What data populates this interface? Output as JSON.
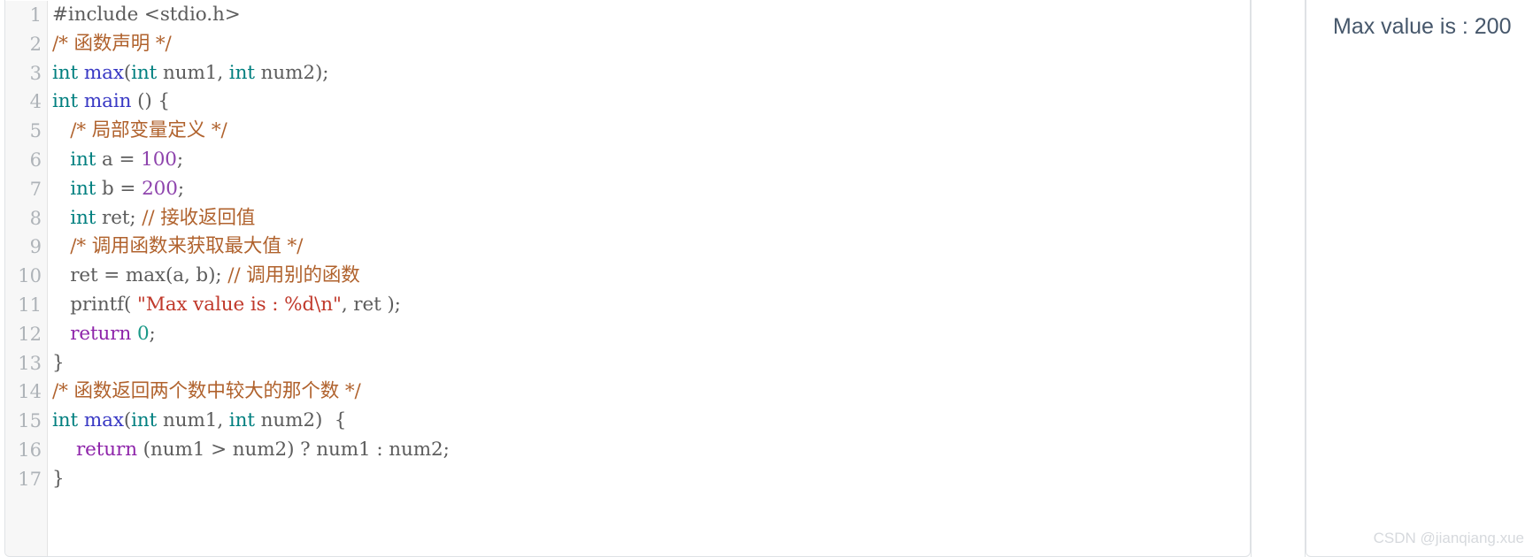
{
  "editor": {
    "language": "c",
    "line_numbers": [
      1,
      2,
      3,
      4,
      5,
      6,
      7,
      8,
      9,
      10,
      11,
      12,
      13,
      14,
      15,
      16,
      17
    ],
    "lines": [
      "#include <stdio.h>",
      "/* 函数声明 */",
      "int max(int num1, int num2);",
      "int main () {",
      "   /* 局部变量定义 */",
      "   int a = 100;",
      "   int b = 200;",
      "   int ret; // 接收返回值",
      "   /* 调用函数来获取最大值 */",
      "   ret = max(a, b); // 调用别的函数",
      "   printf( \"Max value is : %d\\n\", ret );",
      "   return 0;",
      "}",
      "/* 函数返回两个数中较大的那个数 */",
      "int max(int num1, int num2)  {",
      "    return (num1 > num2) ? num1 : num2;",
      "}"
    ],
    "tokens": {
      "l1": [
        {
          "t": "#include <stdio.h>",
          "c": "t-pl"
        }
      ],
      "l2": [
        {
          "t": "/* 函数声明 */",
          "c": "t-com"
        }
      ],
      "l3": [
        {
          "t": "int ",
          "c": "t-kw"
        },
        {
          "t": "max",
          "c": "t-fn"
        },
        {
          "t": "(",
          "c": "t-pl"
        },
        {
          "t": "int",
          "c": "t-kw"
        },
        {
          "t": " num1, ",
          "c": "t-pl"
        },
        {
          "t": "int",
          "c": "t-kw"
        },
        {
          "t": " num2);",
          "c": "t-pl"
        }
      ],
      "l4": [
        {
          "t": "int ",
          "c": "t-kw"
        },
        {
          "t": "main",
          "c": "t-fn"
        },
        {
          "t": " () {",
          "c": "t-pl"
        }
      ],
      "l5": [
        {
          "t": "   /* 局部变量定义 */",
          "c": "t-com"
        }
      ],
      "l6": [
        {
          "t": "   ",
          "c": "t-pl"
        },
        {
          "t": "int",
          "c": "t-kw"
        },
        {
          "t": " a = ",
          "c": "t-pl"
        },
        {
          "t": "100",
          "c": "t-num"
        },
        {
          "t": ";",
          "c": "t-pl"
        }
      ],
      "l7": [
        {
          "t": "   ",
          "c": "t-pl"
        },
        {
          "t": "int",
          "c": "t-kw"
        },
        {
          "t": " b = ",
          "c": "t-pl"
        },
        {
          "t": "200",
          "c": "t-num"
        },
        {
          "t": ";",
          "c": "t-pl"
        }
      ],
      "l8": [
        {
          "t": "   ",
          "c": "t-pl"
        },
        {
          "t": "int",
          "c": "t-kw"
        },
        {
          "t": " ret; ",
          "c": "t-pl"
        },
        {
          "t": "// 接收返回值",
          "c": "t-com"
        }
      ],
      "l9": [
        {
          "t": "   /* 调用函数来获取最大值 */",
          "c": "t-com"
        }
      ],
      "l10": [
        {
          "t": "   ret = max(a, b); ",
          "c": "t-pl"
        },
        {
          "t": "// 调用别的函数",
          "c": "t-com"
        }
      ],
      "l11": [
        {
          "t": "   printf( ",
          "c": "t-pl"
        },
        {
          "t": "\"Max value is : %d\\n\"",
          "c": "t-str"
        },
        {
          "t": ", ret );",
          "c": "t-pl"
        }
      ],
      "l12": [
        {
          "t": "   ",
          "c": "t-pl"
        },
        {
          "t": "return",
          "c": "t-ret"
        },
        {
          "t": " ",
          "c": "t-pl"
        },
        {
          "t": "0",
          "c": "t-num2"
        },
        {
          "t": ";",
          "c": "t-pl"
        }
      ],
      "l13": [
        {
          "t": "}",
          "c": "t-pl"
        }
      ],
      "l14": [
        {
          "t": "/* 函数返回两个数中较大的那个数 */",
          "c": "t-com"
        }
      ],
      "l15": [
        {
          "t": "int ",
          "c": "t-kw"
        },
        {
          "t": "max",
          "c": "t-fn"
        },
        {
          "t": "(",
          "c": "t-pl"
        },
        {
          "t": "int",
          "c": "t-kw"
        },
        {
          "t": " num1, ",
          "c": "t-pl"
        },
        {
          "t": "int",
          "c": "t-kw"
        },
        {
          "t": " num2)  {",
          "c": "t-pl"
        }
      ],
      "l16": [
        {
          "t": "    ",
          "c": "t-pl"
        },
        {
          "t": "return",
          "c": "t-ret"
        },
        {
          "t": " (num1 > num2) ? num1 : num2;",
          "c": "t-pl"
        }
      ],
      "l17": [
        {
          "t": "}",
          "c": "t-pl"
        }
      ]
    }
  },
  "output": {
    "text": "Max value is : 200"
  },
  "watermark": {
    "text": "CSDN @jianqiang.xue"
  },
  "colors": {
    "keyword": "#007f7f",
    "function": "#3838c4",
    "comment": "#b0622d",
    "string": "#c0392b",
    "number": "#8e44ad",
    "return_keyword": "#8e24aa",
    "plain": "#5c5c5c",
    "gutter_text": "#aeb3b8",
    "gutter_bg": "#f7f7f7",
    "panel_border": "#dfe2e5",
    "output_text": "#46576b",
    "watermark": "#d6d9dd"
  }
}
